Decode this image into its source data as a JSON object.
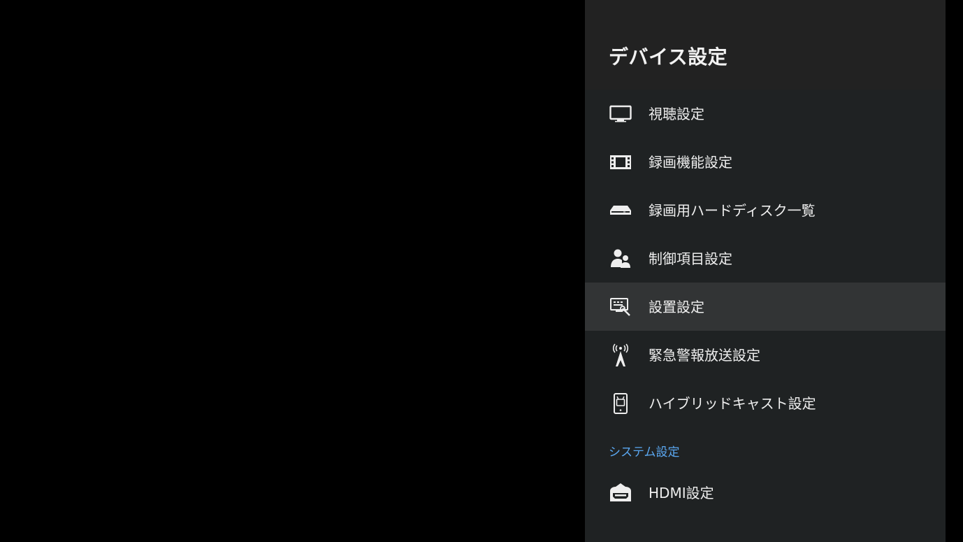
{
  "panel": {
    "title": "デバイス設定"
  },
  "menu": {
    "items": [
      {
        "label": "視聴設定",
        "icon": "tv-monitor-icon",
        "selected": false
      },
      {
        "label": "録画機能設定",
        "icon": "film-strip-icon",
        "selected": false
      },
      {
        "label": "録画用ハードディスク一覧",
        "icon": "hard-disk-icon",
        "selected": false
      },
      {
        "label": "制御項目設定",
        "icon": "users-icon",
        "selected": false
      },
      {
        "label": "設置設定",
        "icon": "installation-tools-icon",
        "selected": true
      },
      {
        "label": "緊急警報放送設定",
        "icon": "broadcast-antenna-icon",
        "selected": false
      },
      {
        "label": "ハイブリッドキャスト設定",
        "icon": "hybridcast-icon",
        "selected": false
      }
    ]
  },
  "system_section": {
    "header": "システム設定",
    "items": [
      {
        "label": "HDMI設定",
        "icon": "hdmi-connector-icon"
      }
    ]
  },
  "colors": {
    "background": "#000000",
    "panel": "#1f2223",
    "header": "#222222",
    "selected": "#323435",
    "text": "#eeeeee",
    "accent": "#5aa7f0"
  }
}
